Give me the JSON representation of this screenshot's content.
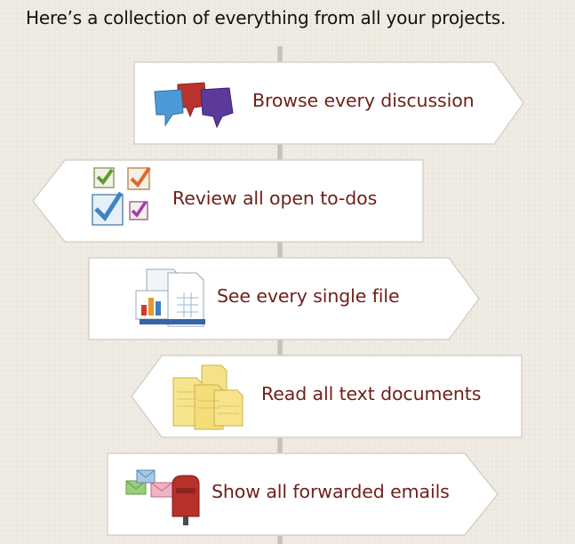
{
  "intro": "Here’s a collection of everything from all your projects.",
  "colors": {
    "label": "#6e1f1a",
    "sign_fill": "#ffffff",
    "sign_border": "#d6d2ca",
    "background": "#efebe2"
  },
  "signs": [
    {
      "label": "Browse every discussion",
      "icon": "speech-bubbles-icon",
      "direction": "right"
    },
    {
      "label": "Review all open to-dos",
      "icon": "checkboxes-icon",
      "direction": "left"
    },
    {
      "label": "See every single file",
      "icon": "files-icon",
      "direction": "right"
    },
    {
      "label": "Read all text documents",
      "icon": "text-documents-icon",
      "direction": "left"
    },
    {
      "label": "Show all forwarded emails",
      "icon": "mailbox-icon",
      "direction": "right"
    }
  ]
}
